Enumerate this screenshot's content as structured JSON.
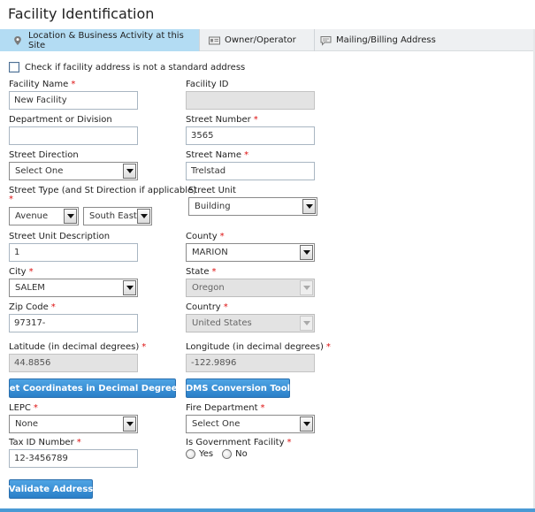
{
  "title": "Facility Identification",
  "tabs": [
    {
      "label": "Location & Business Activity at this Site",
      "icon": "location-pin-icon",
      "active": true
    },
    {
      "label": "Owner/Operator",
      "icon": "id-card-icon",
      "active": false
    },
    {
      "label": "Mailing/Billing Address",
      "icon": "speech-bubble-icon",
      "active": false
    }
  ],
  "checkbox": {
    "label": "Check if facility address is not a standard address",
    "checked": false
  },
  "required_marker": "*",
  "fields": {
    "facility_name": {
      "label": "Facility Name",
      "value": "New Facility"
    },
    "facility_id": {
      "label": "Facility ID",
      "value": ""
    },
    "department": {
      "label": "Department or Division",
      "value": ""
    },
    "street_number": {
      "label": "Street Number",
      "value": "3565"
    },
    "street_direction": {
      "label": "Street Direction",
      "value": "Select One"
    },
    "street_name": {
      "label": "Street Name",
      "value": "Trelstad"
    },
    "street_type": {
      "label": "Street Type (and St Direction if applicable)",
      "value": "Avenue",
      "direction_value": "South East"
    },
    "street_unit": {
      "label": "Street Unit",
      "value": "Building"
    },
    "street_unit_desc": {
      "label": "Street Unit Description",
      "value": "1"
    },
    "county": {
      "label": "County",
      "value": "MARION"
    },
    "city": {
      "label": "City",
      "value": "SALEM"
    },
    "state": {
      "label": "State",
      "value": "Oregon"
    },
    "zip": {
      "label": "Zip Code",
      "value": "97317-"
    },
    "country": {
      "label": "Country",
      "value": "United States"
    },
    "latitude": {
      "label": "Latitude (in decimal degrees)",
      "value": "44.8856"
    },
    "longitude": {
      "label": "Longitude (in decimal degrees)",
      "value": "-122.9896"
    },
    "lepc": {
      "label": "LEPC",
      "value": "None"
    },
    "fire_department": {
      "label": "Fire Department",
      "value": "Select One"
    },
    "tax_id": {
      "label": "Tax ID Number",
      "value": "12-3456789"
    },
    "gov_facility": {
      "label": "Is Government Facility",
      "options": [
        "Yes",
        "No"
      ]
    }
  },
  "buttons": {
    "get_coordinates": "Get Coordinates in Decimal Degrees",
    "dms_conversion": "DMS Conversion Tool",
    "validate_address": "Validate Address"
  },
  "colors": {
    "active_tab": "#b3dcf3",
    "button": "#3b8fd6",
    "required": "#dd1111"
  }
}
